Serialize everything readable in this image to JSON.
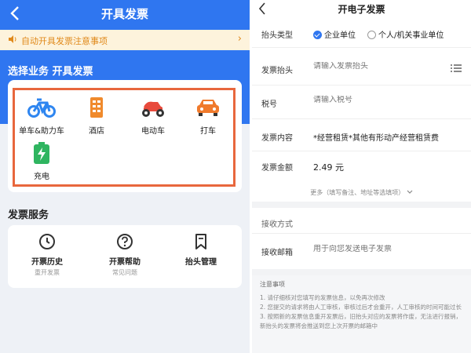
{
  "left": {
    "title": "开具发票",
    "notice": "自动开具发票注意事项",
    "section_title": "选择业务 开具发票",
    "businesses": [
      {
        "label": "单车&助力车",
        "icon": "bicycle-icon",
        "color": "#2f86f0"
      },
      {
        "label": "酒店",
        "icon": "hotel-icon",
        "color": "#f08a2c"
      },
      {
        "label": "电动车",
        "icon": "scooter-icon",
        "color": "#e84a3c"
      },
      {
        "label": "打车",
        "icon": "car-icon",
        "color": "#f07a2c"
      },
      {
        "label": "充电",
        "icon": "battery-icon",
        "color": "#2fb560"
      }
    ],
    "service_title": "发票服务",
    "services": [
      {
        "name": "开票历史",
        "sub": "重开发票",
        "icon": "clock-icon"
      },
      {
        "name": "开票帮助",
        "sub": "常见问题",
        "icon": "question-icon"
      },
      {
        "name": "抬头管理",
        "sub": "",
        "icon": "bookmark-icon"
      }
    ]
  },
  "right": {
    "title": "开电子发票",
    "header_type_label": "抬头类型",
    "header_type_options": [
      "企业单位",
      "个人/机关事业单位"
    ],
    "header_label": "发票抬头",
    "header_placeholder": "请输入发票抬头",
    "tax_label": "税号",
    "tax_placeholder": "请输入税号",
    "content_label": "发票内容",
    "content_value": "*经营租赁*其他有形动产经营租赁费",
    "amount_label": "发票金额",
    "amount_value": "2.49 元",
    "more_text": "更多（填写备注、地址等选填项）",
    "receive_title": "接收方式",
    "email_label": "接收邮箱",
    "email_placeholder": "用于向您发送电子发票",
    "notes_title": "注意事项",
    "notes": [
      "1. 请仔细核对您填写的发票信息，以免再次修改",
      "2. 您提交的请求将由人工审核，审核过后才会重开，人工审核的时间可能过长",
      "3. 按照新的发票信息重开发票后，旧抬头对应的发票将作废，无法进行报销，新抬头的发票将会推送到您上次开票的邮箱中"
    ]
  }
}
